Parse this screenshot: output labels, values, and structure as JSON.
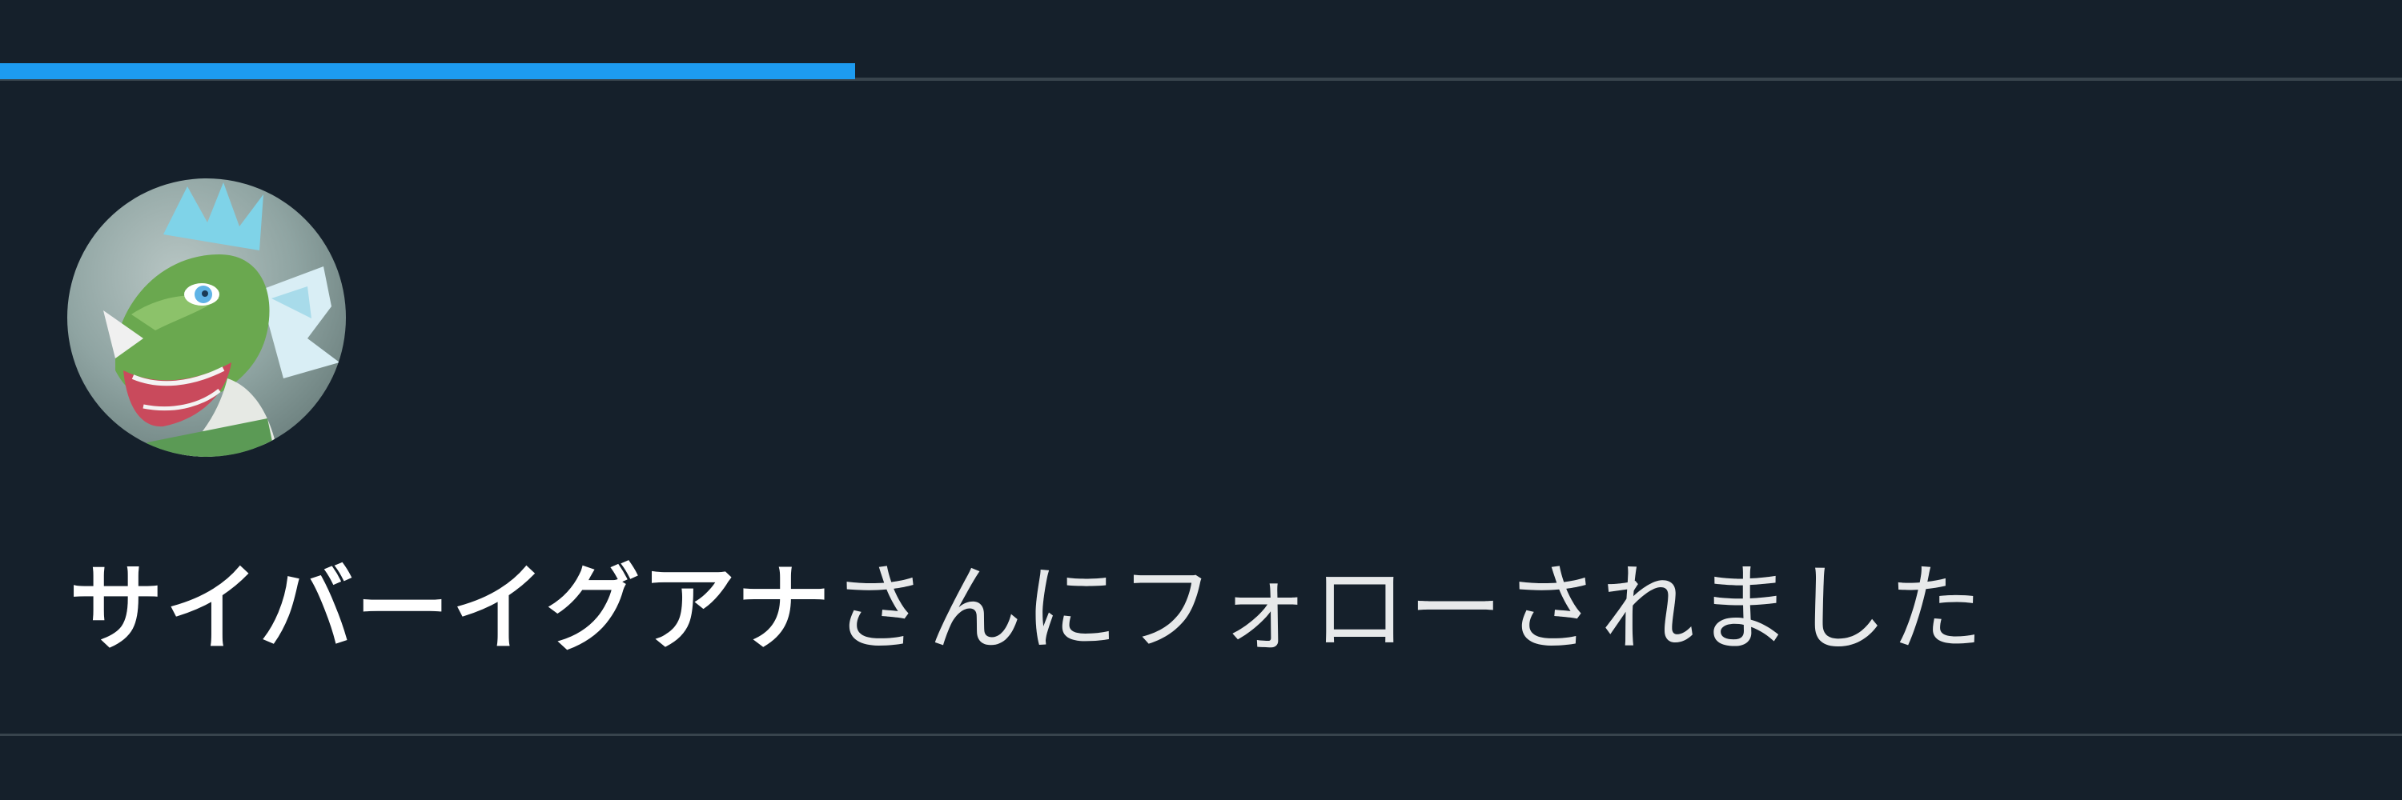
{
  "tabs": {
    "active_accent_color": "#1d9bf0"
  },
  "notification": {
    "type": "follow",
    "avatar": {
      "description_icon": "dragon-avatar"
    },
    "user_name": "サイバーイグアナ",
    "action_text": "さんにフォローされました"
  },
  "colors": {
    "background": "#15202b",
    "divider": "#38444d",
    "text": "#e7e9ea"
  }
}
